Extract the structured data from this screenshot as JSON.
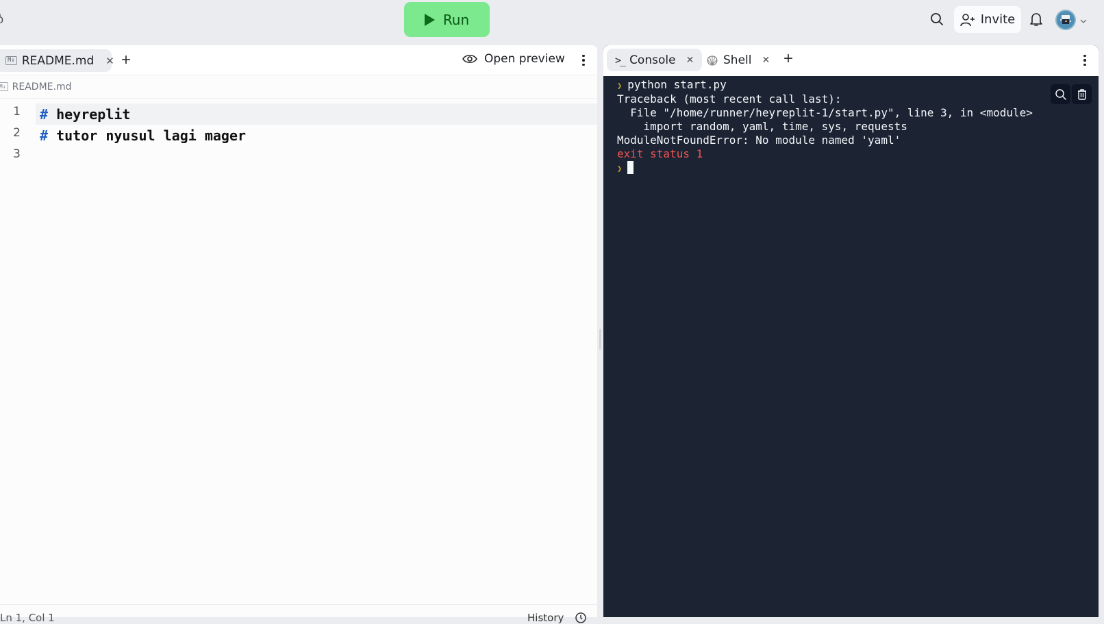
{
  "topbar": {
    "run_label": "Run",
    "invite_label": "Invite",
    "icons": [
      "search-icon",
      "add-user-icon",
      "bell-icon",
      "avatar",
      "chevron-down-icon"
    ]
  },
  "editor": {
    "tabs": [
      {
        "label": "README.md",
        "icon": "markdown-icon",
        "active": true
      }
    ],
    "open_preview_label": "Open preview",
    "breadcrumb": "README.md",
    "lines": [
      {
        "num": "1",
        "hash": "#",
        "text": " heyreplit"
      },
      {
        "num": "2",
        "hash": "#",
        "text": " tutor nyusul lagi mager"
      },
      {
        "num": "3",
        "hash": "",
        "text": ""
      }
    ],
    "status": {
      "position": "Ln 1, Col 1",
      "history_label": "History"
    }
  },
  "console": {
    "tabs": [
      {
        "label": "Console",
        "icon": "terminal-prompt-icon",
        "active": true
      },
      {
        "label": "Shell",
        "icon": "shell-icon",
        "active": false
      }
    ],
    "output": [
      {
        "type": "command",
        "text": "python start.py"
      },
      {
        "type": "stderr",
        "text": "Traceback (most recent call last):"
      },
      {
        "type": "stderr",
        "text": "  File \"/home/runner/heyreplit-1/start.py\", line 3, in <module>"
      },
      {
        "type": "stderr",
        "text": "    import random, yaml, time, sys, requests"
      },
      {
        "type": "stderr",
        "text": "ModuleNotFoundError: No module named 'yaml'"
      },
      {
        "type": "exit",
        "text": "exit status 1"
      }
    ]
  },
  "colors": {
    "run_button": "#7ce98f",
    "console_bg": "#1c2333",
    "error_red": "#f05454",
    "markdown_hash": "#1f5fc2",
    "prompt_caret": "#c9a227"
  }
}
